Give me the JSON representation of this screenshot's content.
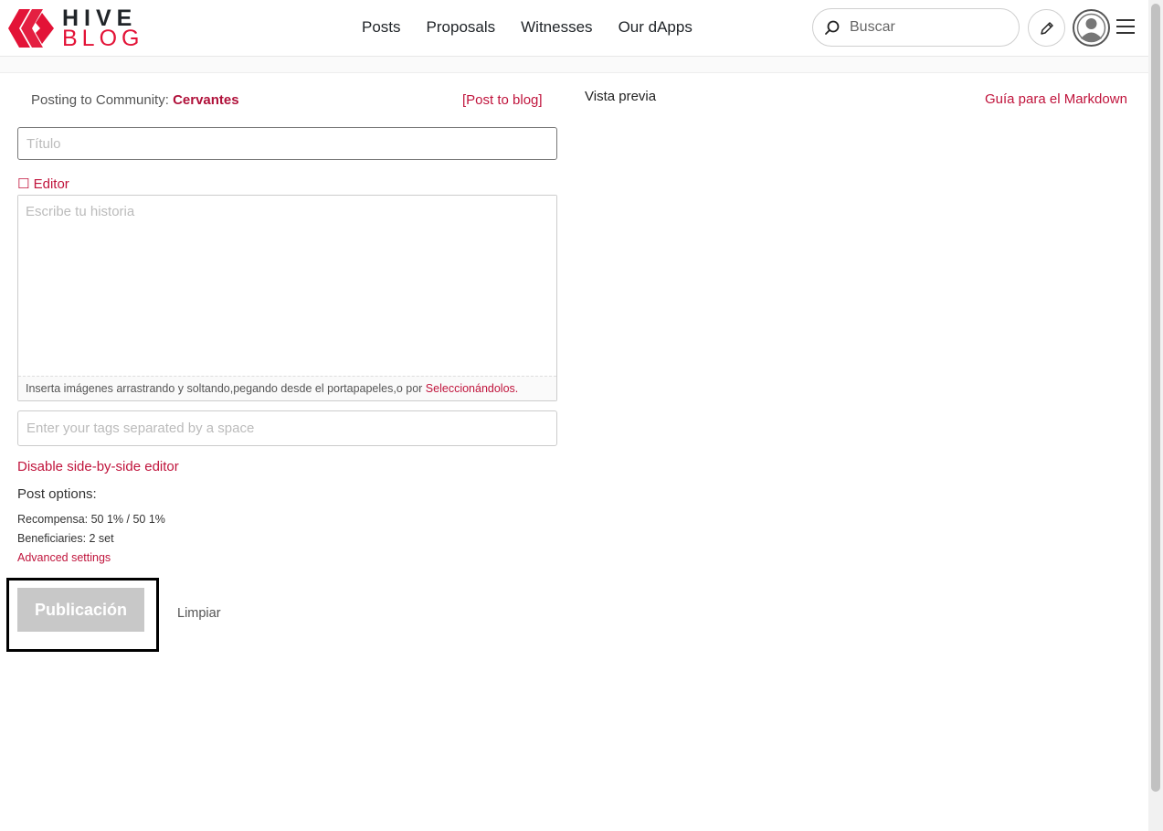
{
  "header": {
    "logo": {
      "line1": "HIVE",
      "line2": "BLOG"
    },
    "nav": [
      "Posts",
      "Proposals",
      "Witnesses",
      "Our dApps"
    ],
    "search_placeholder": "Buscar",
    "icons": {
      "search": "search-icon",
      "pencil": "pencil-icon",
      "avatar": "user-icon",
      "menu": "hamburger-icon"
    }
  },
  "editor": {
    "posting_prefix": "Posting to Community: ",
    "community": "Cervantes",
    "post_to_blog": "[Post to blog]",
    "title_placeholder": "Título",
    "editor_toggle": "☐ Editor",
    "body_placeholder": "Escribe tu historia",
    "drop_hint_prefix": "Inserta imágenes arrastrando y soltando,pegando desde el portapapeles,o por ",
    "drop_hint_link": "Seleccionándolos.",
    "tags_placeholder": "Enter your tags separated by a space",
    "disable_side_by_side": "Disable side-by-side editor",
    "post_options_label": "Post options:",
    "reward": "Recompensa: 50 1% / 50 1%",
    "beneficiaries": "Beneficiaries: 2 set",
    "advanced_settings": "Advanced settings",
    "publish_label": "Publicación",
    "clear_label": "Limpiar"
  },
  "preview": {
    "label": "Vista previa",
    "markdown_guide": "Guía para el Markdown"
  },
  "colors": {
    "accent": "#e31337",
    "link": "#c0143c",
    "publish_disabled": "#c8c8c8"
  }
}
